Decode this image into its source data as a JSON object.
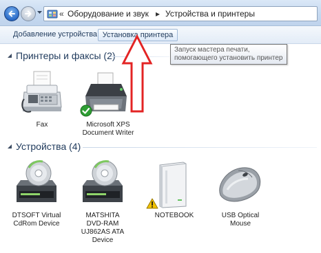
{
  "address_bar": {
    "overflow_chevron": "«",
    "breadcrumbs": [
      {
        "label": "Оборудование и звук"
      },
      {
        "label": "Устройства и принтеры"
      }
    ],
    "separator": "▸"
  },
  "command_bar": {
    "add_device_label": "Добавление устройства",
    "add_printer_label": "Установка принтера"
  },
  "tooltip": {
    "lines": [
      "Запуск мастера печати,",
      "помогающего установить принтер"
    ]
  },
  "groups": [
    {
      "title": "Принтеры и факсы (2)",
      "items": [
        {
          "label_lines": [
            "Fax"
          ],
          "icon": "fax-icon"
        },
        {
          "label_lines": [
            "Microsoft XPS",
            "Document Writer"
          ],
          "icon": "printer-icon",
          "default": true
        }
      ]
    },
    {
      "title": "Устройства (4)",
      "items": [
        {
          "label_lines": [
            "DTSOFT Virtual",
            "CdRom Device"
          ],
          "icon": "cd-drive-icon"
        },
        {
          "label_lines": [
            "MATSHITA",
            "DVD-RAM",
            "UJ862AS ATA",
            "Device"
          ],
          "icon": "cd-drive-icon"
        },
        {
          "label_lines": [
            "NOTEBOOK"
          ],
          "icon": "computer-tower-icon",
          "warning": true
        },
        {
          "label_lines": [
            "USB Optical",
            "Mouse"
          ],
          "icon": "mouse-icon"
        }
      ]
    }
  ],
  "colors": {
    "group_title": "#1e395b",
    "arrow": "#e32424",
    "default_badge": "#2e9e33",
    "warning_badge": "#f2c200"
  }
}
